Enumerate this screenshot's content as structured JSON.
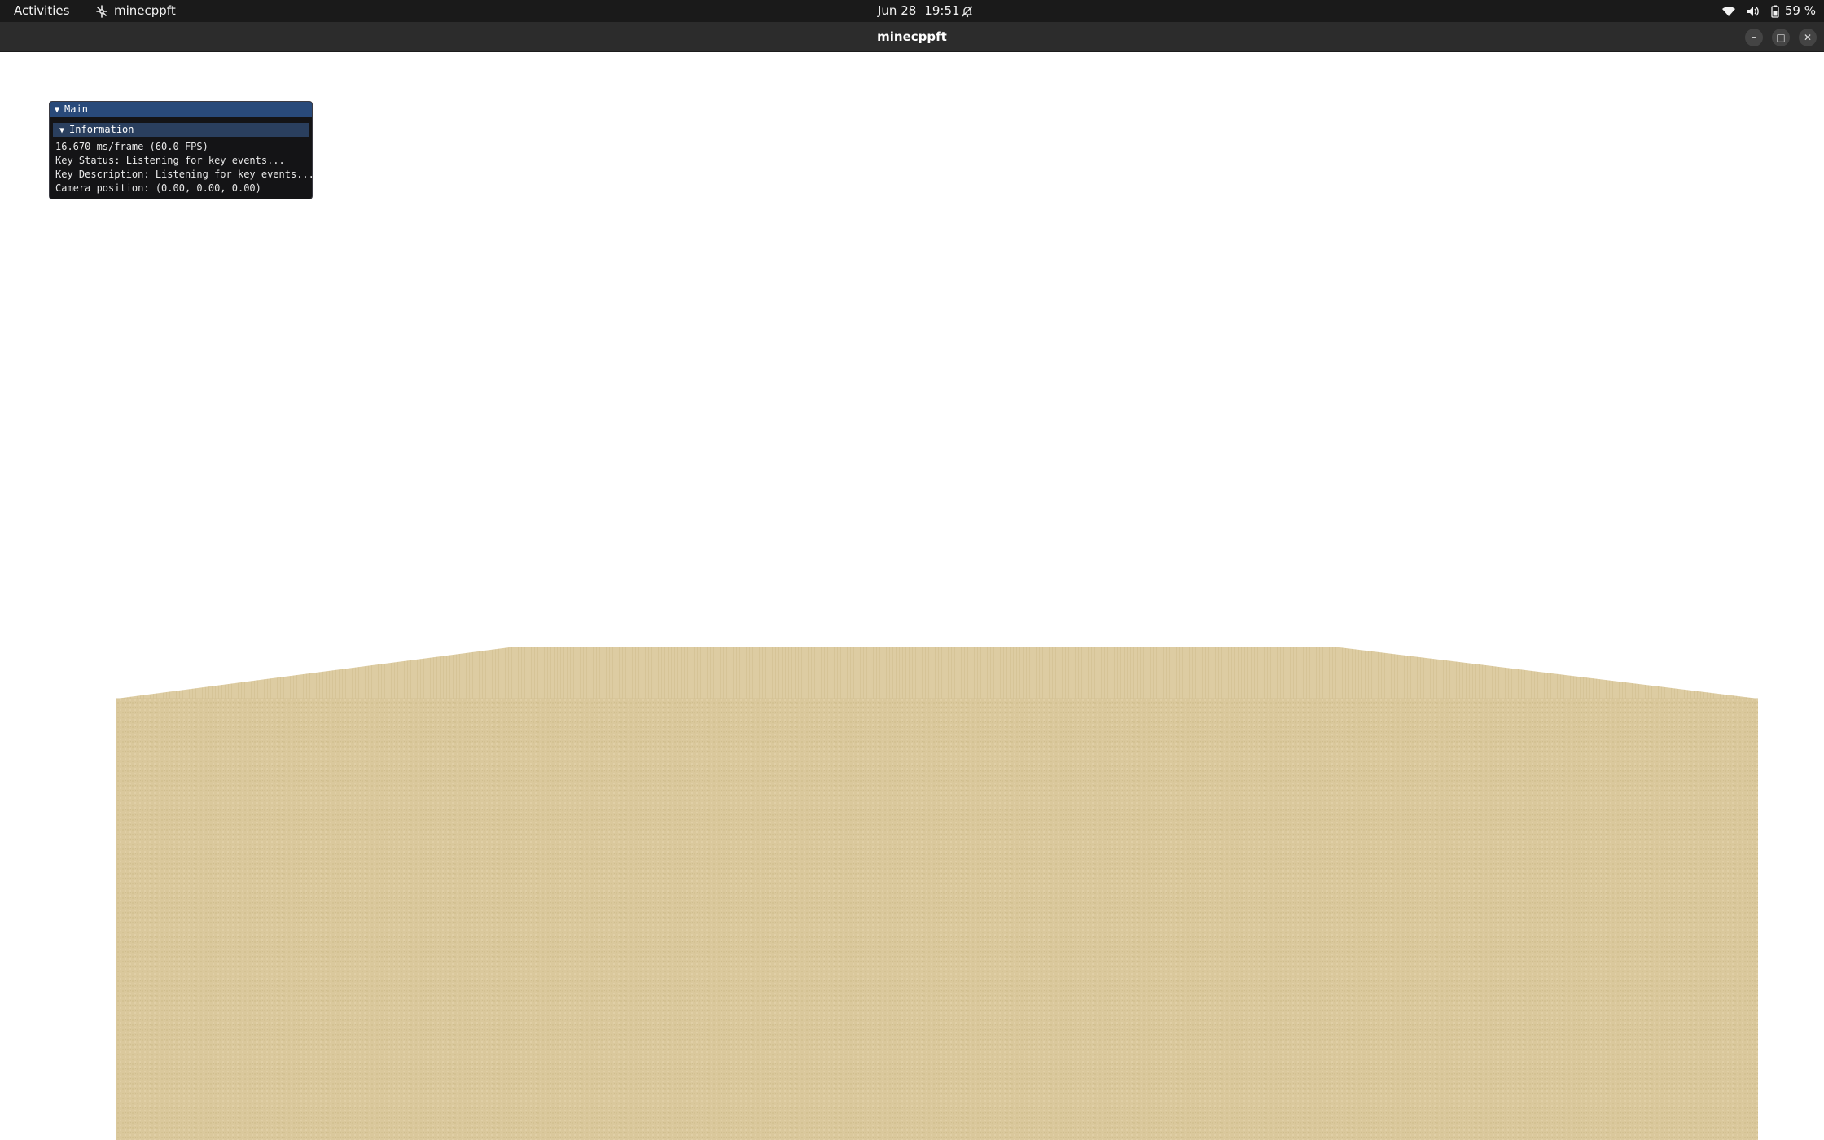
{
  "topbar": {
    "activities": "Activities",
    "app_name": "minecppft",
    "date": "Jun 28",
    "time": "19:51",
    "battery_percent": "59 %",
    "icons": [
      "app-gear-icon",
      "notifications-off-icon",
      "wifi-icon",
      "volume-icon",
      "battery-icon"
    ]
  },
  "window": {
    "title": "minecppft",
    "buttons": {
      "minimize": "–",
      "maximize": "□",
      "close": "✕"
    }
  },
  "imgui": {
    "window_title": "Main",
    "section_title": "Information",
    "lines": [
      "16.670 ms/frame (60.0 FPS)",
      "Key Status: Listening for key events...",
      "Key Description: Listening for key events...",
      "Camera position: (0.00, 0.00, 0.00)"
    ]
  },
  "colors": {
    "sky": "#ffffff",
    "sand_top": "#dccba0",
    "sand_front": "#d9c79b",
    "topbar": "#1a1a1a",
    "titlebar": "#2c2c2c",
    "imgui_title": "#294a7a",
    "imgui_header": "#2a3f5e"
  }
}
